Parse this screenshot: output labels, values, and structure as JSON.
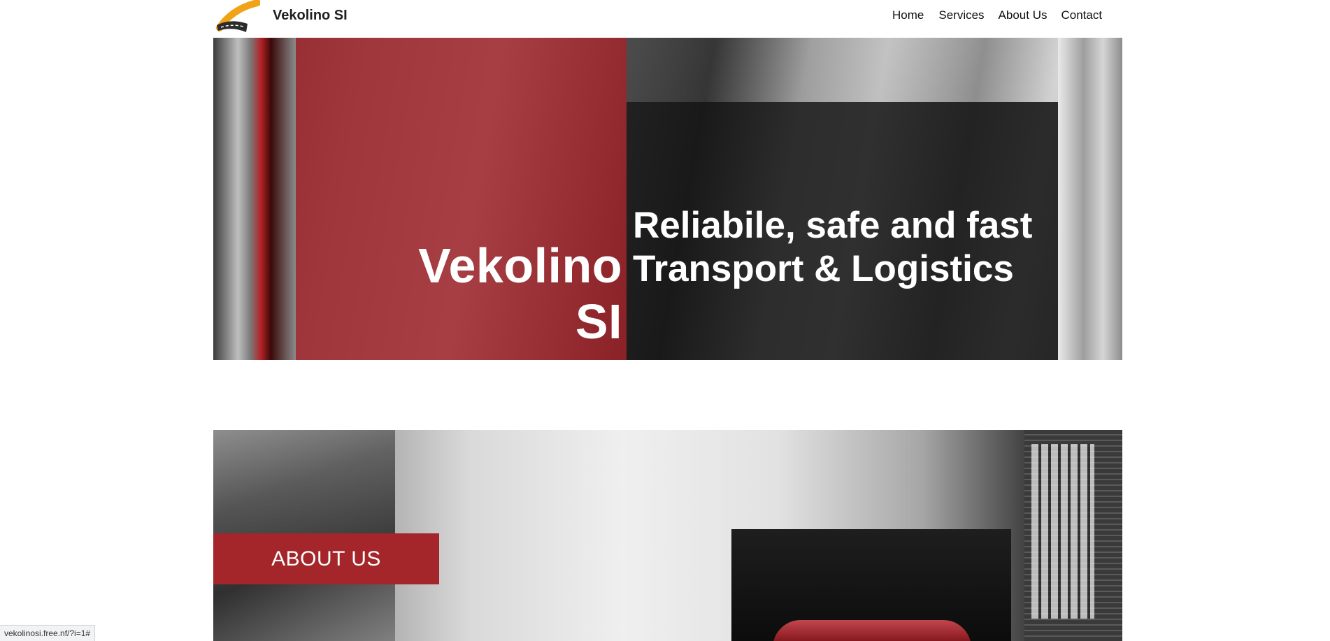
{
  "header": {
    "brand": "Vekolino SI",
    "nav": [
      "Home",
      "Services",
      "About Us",
      "Contact"
    ]
  },
  "hero": {
    "title": "Vekolino SI",
    "subtitle_line1": "Reliabile, safe and fast",
    "subtitle_line2": "Transport & Logistics"
  },
  "about": {
    "badge": "ABOUT US"
  },
  "status_bar": {
    "url": "vekolinosi.free.nf/?i=1#"
  },
  "colors": {
    "accent_red": "#a4262b",
    "dark_panel": "#141414"
  }
}
